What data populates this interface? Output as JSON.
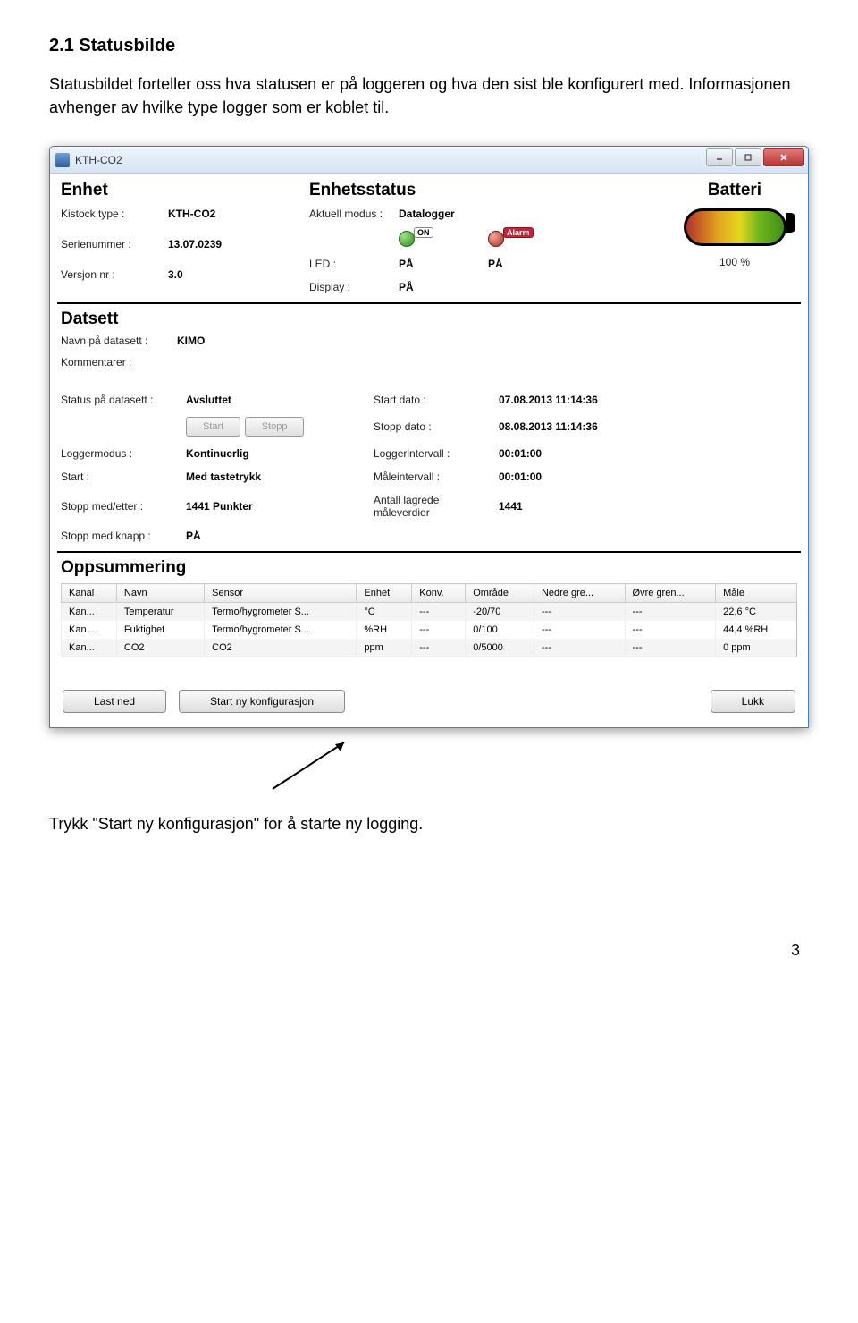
{
  "doc": {
    "heading": "2.1 Statusbilde",
    "paragraph": "Statusbildet forteller oss hva statusen er på loggeren og hva den sist ble konfigurert med. Informasjonen avhenger av hvilke type logger som er koblet til.",
    "footer_text": "Trykk \"Start ny konfigurasjon\" for å starte ny logging.",
    "page_number": "3"
  },
  "window": {
    "title": "KTH-CO2"
  },
  "enhet": {
    "title": "Enhet",
    "kistock_label": "Kistock type :",
    "kistock_value": "KTH-CO2",
    "serial_label": "Serienummer :",
    "serial_value": "13.07.0239",
    "version_label": "Versjon nr :",
    "version_value": "3.0"
  },
  "status": {
    "title": "Enhetsstatus",
    "mode_label": "Aktuell modus :",
    "mode_value": "Datalogger",
    "on_tag": "ON",
    "alarm_tag": "Alarm",
    "led_label": "LED :",
    "led_value": "PÅ",
    "led_value2": "PÅ",
    "display_label": "Display :",
    "display_value": "PÅ"
  },
  "battery": {
    "title": "Batteri",
    "value": "100 %"
  },
  "datsett": {
    "title": "Datsett",
    "name_label": "Navn på datasett :",
    "name_value": "KIMO",
    "comments_label": "Kommentarer :",
    "status_label": "Status på datasett :",
    "status_value": "Avsluttet",
    "start_btn": "Start",
    "stop_btn": "Stopp",
    "startdate_label": "Start dato :",
    "startdate_value": "07.08.2013 11:14:36",
    "stopdate_label": "Stopp dato :",
    "stopdate_value": "08.08.2013 11:14:36",
    "loggermode_label": "Loggermodus :",
    "loggermode_value": "Kontinuerlig",
    "loginterval_label": "Loggerintervall :",
    "loginterval_value": "00:01:00",
    "start_label": "Start :",
    "start_value": "Med tastetrykk",
    "measinterval_label": "Måleintervall :",
    "measinterval_value": "00:01:00",
    "stopafter_label": "Stopp med/etter :",
    "stopafter_value": "1441 Punkter",
    "stored_label": "Antall lagrede måleverdier",
    "stored_value": "1441",
    "stopbtn_label": "Stopp med knapp :",
    "stopbtn_value": "PÅ"
  },
  "opps": {
    "title": "Oppsummering",
    "headers": [
      "Kanal",
      "Navn",
      "Sensor",
      "Enhet",
      "Konv.",
      "Område",
      "Nedre gre...",
      "Øvre gren...",
      "Måle"
    ],
    "rows": [
      [
        "Kan...",
        "Temperatur",
        "Termo/hygrometer S...",
        "°C",
        "---",
        "-20/70",
        "---",
        "---",
        "22,6 °C"
      ],
      [
        "Kan...",
        "Fuktighet",
        "Termo/hygrometer S...",
        "%RH",
        "---",
        "0/100",
        "---",
        "---",
        "44,4 %RH"
      ],
      [
        "Kan...",
        "CO2",
        "CO2",
        "ppm",
        "---",
        "0/5000",
        "---",
        "---",
        "0 ppm"
      ]
    ]
  },
  "footer_buttons": {
    "download": "Last ned",
    "startconfig": "Start ny konfigurasjon",
    "close": "Lukk"
  }
}
